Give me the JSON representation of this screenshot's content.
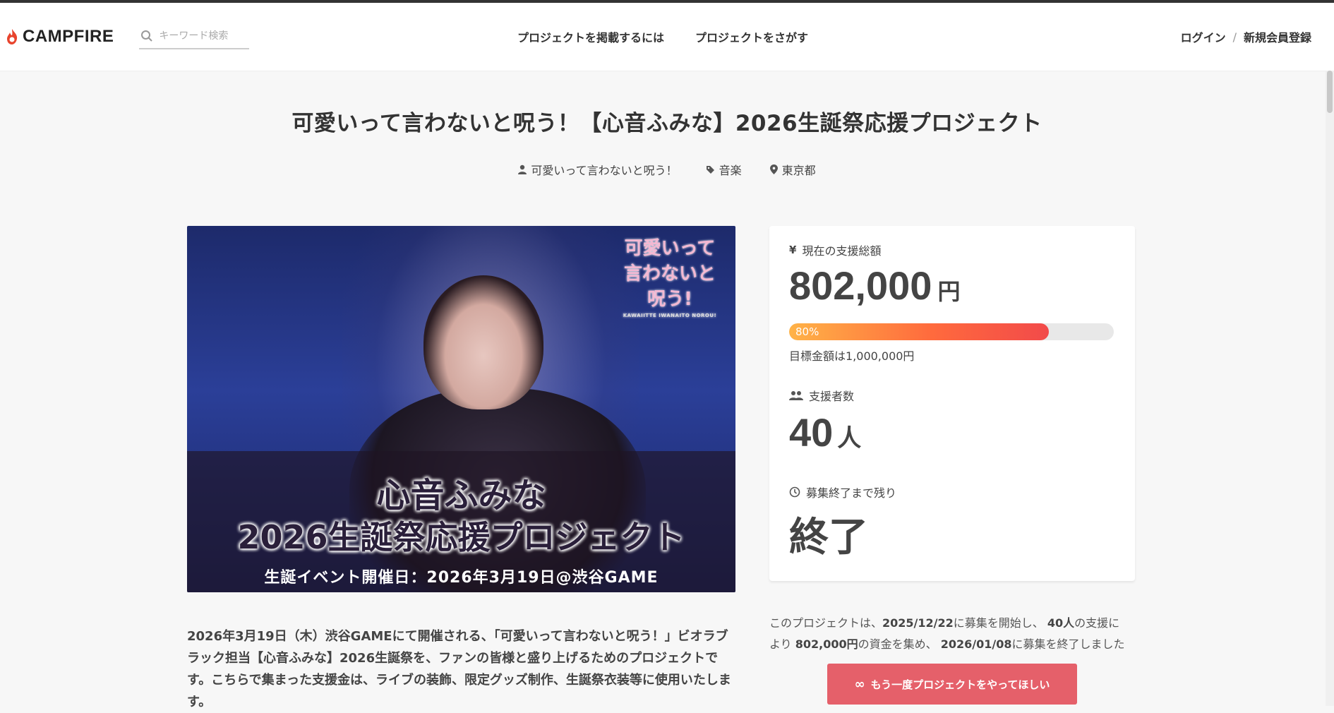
{
  "header": {
    "logo_text": "CAMPFIRE",
    "search_placeholder": "キーワード検索",
    "nav": [
      "プロジェクトを掲載するには",
      "プロジェクトをさがす"
    ],
    "login": "ログイン",
    "separator": "/",
    "signup": "新規会員登録"
  },
  "project": {
    "title": "可愛いって言わないと呪う！【心音ふみな】2026生誕祭応援プロジェクト",
    "owner": "可愛いって言わないと呪う！",
    "category": "音楽",
    "location": "東京都"
  },
  "hero": {
    "logo_line1": "可愛いって",
    "logo_line2": "言わないと",
    "logo_line3": "呪う!",
    "logo_sub": "KAWAIITTE IWANAITO NOROU!",
    "headline1": "心音ふみな",
    "headline2": "2026生誕祭応援プロジェクト",
    "event_line": "生誕イベント開催日：2026年3月19日@渋谷GAME"
  },
  "stats": {
    "amount_label": "現在の支援総額",
    "amount": "802,000",
    "amount_unit": "円",
    "progress_label": "80%",
    "progress_value": 0.8,
    "goal_text": "目標金額は1,000,000円",
    "backers_label": "支援者数",
    "backers": "40",
    "backers_unit": "人",
    "remaining_label": "募集終了まで残り",
    "remaining_value": "終了"
  },
  "description": "2026年3月19日（木）渋谷GAMEにて開催される、「可愛いって言わないと呪う！」ビオラブラック担当【心音ふみな】2026生誕祭を、ファンの皆様と盛り上げるためのプロジェクトです。こちらで集まった支援金は、ライブの装飾、限定グッズ制作、生誕祭衣装等に使用いたします。",
  "summary": {
    "p1": "このプロジェクトは、",
    "start_date": "2025/12/22",
    "p2": "に募集を開始し、 ",
    "backers": "40人",
    "p3": "の支援により ",
    "amount": "802,000円",
    "p4": "の資金を集め、 ",
    "end_date": "2026/01/08",
    "p5": "に募集を終了しました"
  },
  "cta_label": "もう一度プロジェクトをやってほしい",
  "colors": {
    "accent": "#e5606a",
    "progress_start": "#ffb347",
    "progress_end": "#f24a4a",
    "logo_flame": "#e8442d"
  }
}
